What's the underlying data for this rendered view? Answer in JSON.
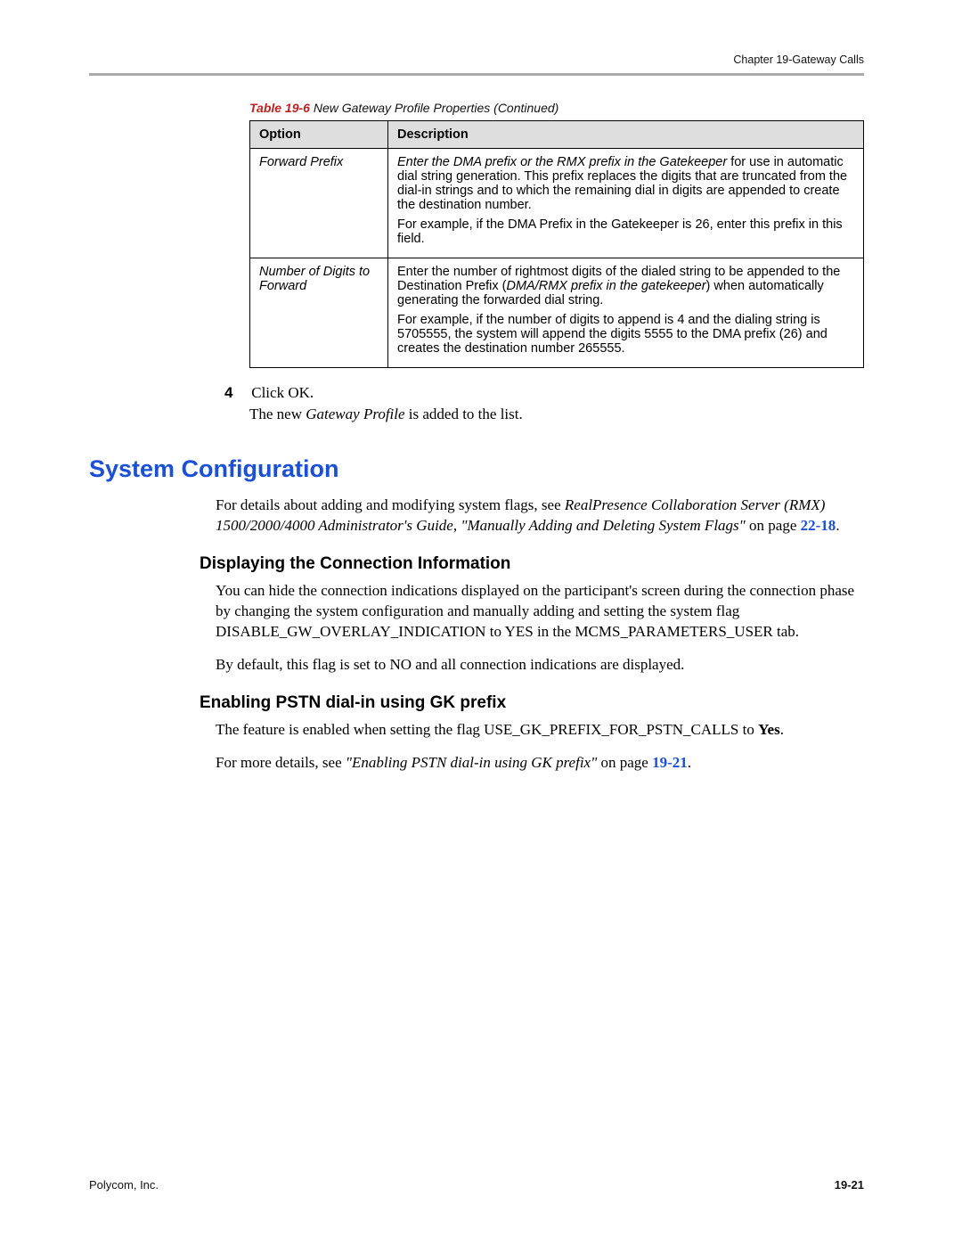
{
  "header": {
    "chapter": "Chapter 19-Gateway Calls"
  },
  "tableCaption": {
    "num": "Table 19-6",
    "text": "New Gateway Profile Properties (Continued)"
  },
  "table": {
    "headers": {
      "col1": "Option",
      "col2": "Description"
    },
    "rows": [
      {
        "option": "Forward Prefix",
        "desc_lead_italic": "Enter the DMA prefix or the RMX prefix in the Gatekeeper",
        "desc_rest": " for use in automatic dial string generation. This prefix replaces the digits that are truncated from the dial-in strings and to which the remaining dial in digits are appended to create the destination number.",
        "desc_para2": "For example, if the DMA Prefix in the Gatekeeper is 26, enter this prefix in this field."
      },
      {
        "option": "Number of Digits to Forward",
        "desc_plain1": "Enter the number of rightmost digits of the dialed string to be appended to the Destination Prefix (",
        "desc_italic1": "DMA/RMX prefix in the gatekeeper",
        "desc_plain2": ") when automatically generating the forwarded dial string.",
        "desc_para2": "For example, if the number of digits to append is 4 and the dialing string is 5705555, the system will append the digits 5555 to the DMA prefix (26) and creates the destination number 265555."
      }
    ]
  },
  "step": {
    "num": "4",
    "text": "Click OK.",
    "result_pre": "The new ",
    "result_italic": "Gateway Profile",
    "result_post": " is added to the list."
  },
  "section": {
    "title": "System Configuration",
    "intro_pre": "For details about adding and modifying system flags, see ",
    "intro_italic": "RealPresence Collaboration Server (RMX) 1500/2000/4000 Administrator's Guide",
    "intro_mid": ", ",
    "intro_quote": "\"Manually Adding and Deleting System Flags\"",
    "intro_on": " on page ",
    "intro_xref": "22-18",
    "intro_end": "."
  },
  "sub1": {
    "title": "Displaying the Connection Information",
    "p1_a": "You can hide the connection indications displayed on the participant's screen during the connection phase by changing the system configuration and manually adding and setting the system flag ",
    "p1_flag": "DISABLE_GW_OVERLAY_INDICATION",
    "p1_b": " to ",
    "p1_yes": "YES",
    "p1_c": " in the MCMS_PARAMETERS_USER tab.",
    "p2": "By default, this flag is set to NO and all connection indications are displayed."
  },
  "sub2": {
    "title": "Enabling PSTN dial-in using GK prefix",
    "p1_a": "The feature is enabled when setting the flag ",
    "p1_flag": "USE_GK_PREFIX_FOR_PSTN_CALLS",
    "p1_b": " to ",
    "p1_yes": "Yes",
    "p1_c": ".",
    "p2_a": "For more details, see ",
    "p2_quote": "\"Enabling PSTN dial-in using GK prefix\"",
    "p2_on": " on page ",
    "p2_xref": "19-21",
    "p2_end": "."
  },
  "footer": {
    "left": "Polycom, Inc.",
    "right": "19-21"
  }
}
